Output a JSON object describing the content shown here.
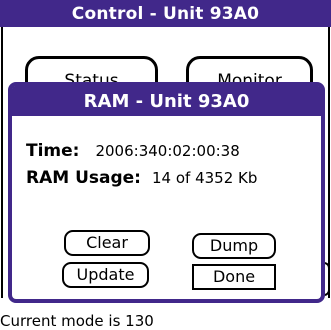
{
  "window": {
    "title": "Control - Unit 93A0"
  },
  "background_buttons": {
    "status_label": "Status",
    "monitor_label": "Monitor"
  },
  "status_line": "Current mode is 130",
  "dialog": {
    "title": "RAM - Unit 93A0",
    "time_label": "Time:",
    "time_value": "2006:340:02:00:38",
    "ram_label": "RAM Usage:",
    "ram_value": "14 of 4352 Kb",
    "buttons": {
      "clear": "Clear",
      "dump": "Dump",
      "update": "Update",
      "done": "Done"
    }
  },
  "colors": {
    "title_bar": "#41288a",
    "background": "#ffffff",
    "text": "#000000"
  }
}
